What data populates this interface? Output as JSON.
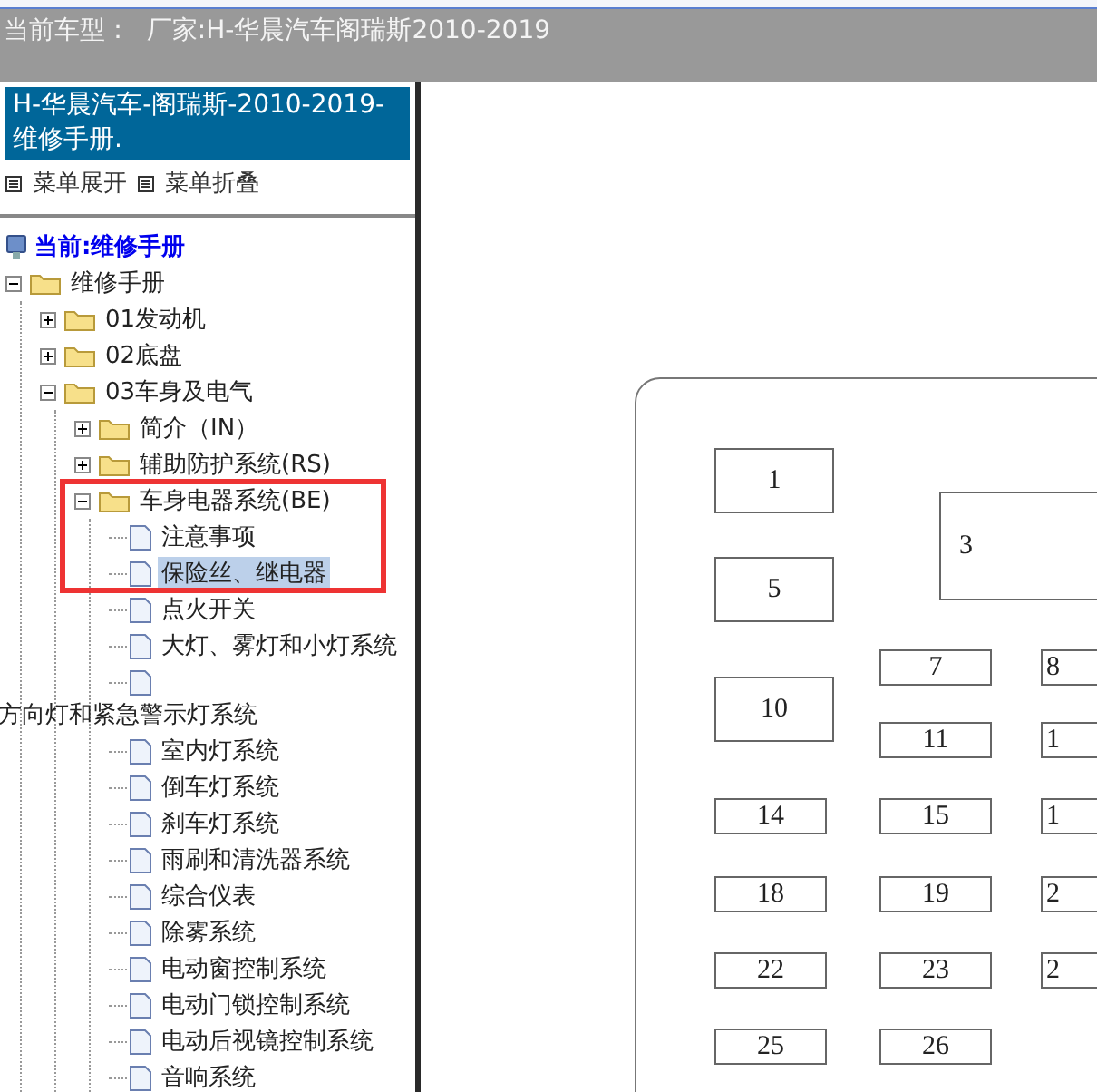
{
  "top_bar": {
    "text": "当前车型：  厂家:H-华晨汽车阁瑞斯2010-2019"
  },
  "sidebar": {
    "title": "H-华晨汽车-阁瑞斯-2010-2019- 维修手册.",
    "menu_actions": [
      {
        "label": "菜单展开"
      },
      {
        "label": "菜单折叠"
      }
    ],
    "current": "当前:维修手册",
    "tree": [
      {
        "label": "维修手册",
        "kind": "folder",
        "expanded": true,
        "selected": false,
        "children": [
          {
            "label": "01发动机",
            "kind": "folder",
            "expanded": false,
            "selected": false
          },
          {
            "label": "02底盘",
            "kind": "folder",
            "expanded": false,
            "selected": false
          },
          {
            "label": "03车身及电气",
            "kind": "folder",
            "expanded": true,
            "selected": false,
            "children": [
              {
                "label": "简介（IN）",
                "kind": "folder",
                "expanded": false,
                "selected": false
              },
              {
                "label": "辅助防护系统(RS)",
                "kind": "folder",
                "expanded": false,
                "selected": false
              },
              {
                "label": "车身电器系统(BE)",
                "kind": "folder",
                "expanded": true,
                "selected": false,
                "children": [
                  {
                    "label": "注意事项",
                    "kind": "doc",
                    "selected": false
                  },
                  {
                    "label": "保险丝、继电器",
                    "kind": "doc",
                    "selected": true
                  },
                  {
                    "label": "点火开关",
                    "kind": "doc",
                    "selected": false
                  },
                  {
                    "label": "大灯、雾灯和小灯系统",
                    "kind": "doc",
                    "selected": false
                  },
                  {
                    "label": "方向灯和紧急警示灯系统",
                    "kind": "doc-wrap",
                    "selected": false
                  },
                  {
                    "label": "室内灯系统",
                    "kind": "doc",
                    "selected": false
                  },
                  {
                    "label": "倒车灯系统",
                    "kind": "doc",
                    "selected": false
                  },
                  {
                    "label": "刹车灯系统",
                    "kind": "doc",
                    "selected": false
                  },
                  {
                    "label": "雨刷和清洗器系统",
                    "kind": "doc",
                    "selected": false
                  },
                  {
                    "label": "综合仪表",
                    "kind": "doc",
                    "selected": false
                  },
                  {
                    "label": "除雾系统",
                    "kind": "doc",
                    "selected": false
                  },
                  {
                    "label": "电动窗控制系统",
                    "kind": "doc",
                    "selected": false
                  },
                  {
                    "label": "电动门锁控制系统",
                    "kind": "doc",
                    "selected": false
                  },
                  {
                    "label": "电动后视镜控制系统",
                    "kind": "doc",
                    "selected": false
                  },
                  {
                    "label": "音响系统",
                    "kind": "doc",
                    "selected": false
                  }
                ]
              }
            ]
          }
        ]
      }
    ]
  },
  "diagram": {
    "fuses": [
      "1",
      "3",
      "5",
      "7",
      "8",
      "10",
      "11",
      "1",
      "14",
      "15",
      "1",
      "18",
      "19",
      "2",
      "22",
      "23",
      "2",
      "25",
      "26"
    ]
  }
}
